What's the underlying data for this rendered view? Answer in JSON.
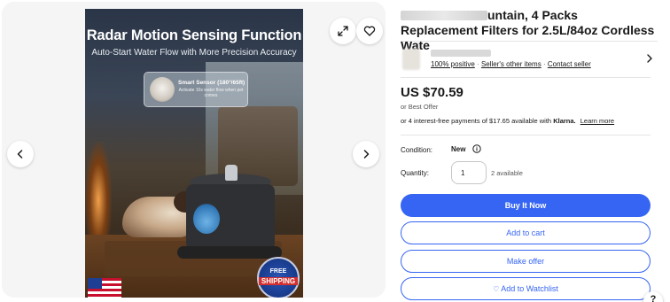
{
  "gallery": {
    "image": {
      "headline": "Radar Motion Sensing Function",
      "subheadline": "Auto-Start Water Flow with More Precision Accuracy",
      "sensor_title": "Smart Sensor (180°/65ft)",
      "sensor_desc": "Activate 10s water flow when pet comes",
      "badge_top": "FREE",
      "badge_bottom": "SHIPPING"
    },
    "icons": {
      "expand": "expand-icon",
      "favorite": "heart-icon",
      "prev": "chevron-left-icon",
      "next": "chevron-right-icon"
    }
  },
  "listing": {
    "title_visible": "untain, 4 Packs Replacement Filters for 2.5L/84oz Cordless Wate",
    "seller": {
      "positive": "100% positive",
      "other_items": "Seller's other items",
      "contact": "Contact seller"
    },
    "price": "US $70.59",
    "best_offer": "or Best Offer",
    "installments_prefix": "or 4 interest-free payments of $17.65 available with",
    "klarna": "Klarna.",
    "learn_more": "Learn more",
    "condition_label": "Condition:",
    "condition_value": "New",
    "quantity_label": "Quantity:",
    "quantity_value": "1",
    "available": "2 available",
    "buttons": {
      "buy": "Buy It Now",
      "cart": "Add to cart",
      "offer": "Make offer",
      "watch": "Add to Watchlist"
    },
    "help": "?"
  },
  "colors": {
    "primary": "#3665f3",
    "text": "#191919",
    "gallery_bg": "#f5f5f5"
  }
}
